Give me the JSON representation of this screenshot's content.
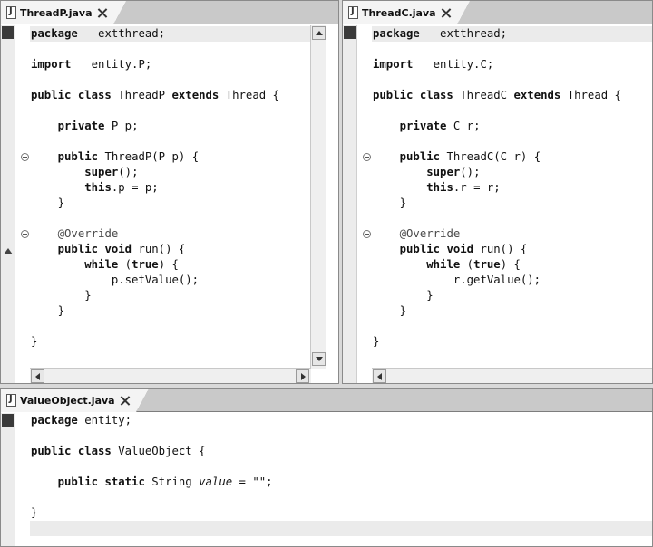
{
  "editors": {
    "threadP": {
      "tab": "ThreadP.java",
      "lines": [
        [
          [
            "kw",
            "package"
          ],
          [
            "",
            "   extthread;"
          ]
        ],
        [],
        [
          [
            "kw",
            "import"
          ],
          [
            "",
            "   entity.P;"
          ]
        ],
        [],
        [
          [
            "kw",
            "public class"
          ],
          [
            "",
            " ThreadP "
          ],
          [
            "kw",
            "extends"
          ],
          [
            "",
            " Thread {"
          ]
        ],
        [],
        [
          [
            "",
            "    "
          ],
          [
            "kw",
            "private"
          ],
          [
            "",
            " P p;"
          ]
        ],
        [],
        [
          [
            "",
            "    "
          ],
          [
            "kw",
            "public"
          ],
          [
            "",
            " ThreadP(P p) {"
          ]
        ],
        [
          [
            "",
            "        "
          ],
          [
            "kw",
            "super"
          ],
          [
            "",
            "();"
          ]
        ],
        [
          [
            "",
            "        "
          ],
          [
            "kw",
            "this"
          ],
          [
            "",
            ".p = p;"
          ]
        ],
        [
          [
            "",
            "    }"
          ]
        ],
        [],
        [
          [
            "",
            "    "
          ],
          [
            "ann",
            "@Override"
          ]
        ],
        [
          [
            "",
            "    "
          ],
          [
            "kw",
            "public void"
          ],
          [
            "",
            " run() {"
          ]
        ],
        [
          [
            "",
            "        "
          ],
          [
            "kw",
            "while"
          ],
          [
            "",
            " ("
          ],
          [
            "kw",
            "true"
          ],
          [
            "",
            ") {"
          ]
        ],
        [
          [
            "",
            "            p.setValue();"
          ]
        ],
        [
          [
            "",
            "        }"
          ]
        ],
        [
          [
            "",
            "    }"
          ]
        ],
        [],
        [
          [
            "",
            "}"
          ]
        ]
      ]
    },
    "threadC": {
      "tab": "ThreadC.java",
      "lines": [
        [
          [
            "kw",
            "package"
          ],
          [
            "",
            "   extthread;"
          ]
        ],
        [],
        [
          [
            "kw",
            "import"
          ],
          [
            "",
            "   entity.C;"
          ]
        ],
        [],
        [
          [
            "kw",
            "public class"
          ],
          [
            "",
            " ThreadC "
          ],
          [
            "kw",
            "extends"
          ],
          [
            "",
            " Thread {"
          ]
        ],
        [],
        [
          [
            "",
            "    "
          ],
          [
            "kw",
            "private"
          ],
          [
            "",
            " C r;"
          ]
        ],
        [],
        [
          [
            "",
            "    "
          ],
          [
            "kw",
            "public"
          ],
          [
            "",
            " ThreadC(C r) {"
          ]
        ],
        [
          [
            "",
            "        "
          ],
          [
            "kw",
            "super"
          ],
          [
            "",
            "();"
          ]
        ],
        [
          [
            "",
            "        "
          ],
          [
            "kw",
            "this"
          ],
          [
            "",
            ".r = r;"
          ]
        ],
        [
          [
            "",
            "    }"
          ]
        ],
        [],
        [
          [
            "",
            "    "
          ],
          [
            "ann",
            "@Override"
          ]
        ],
        [
          [
            "",
            "    "
          ],
          [
            "kw",
            "public void"
          ],
          [
            "",
            " run() {"
          ]
        ],
        [
          [
            "",
            "        "
          ],
          [
            "kw",
            "while"
          ],
          [
            "",
            " ("
          ],
          [
            "kw",
            "true"
          ],
          [
            "",
            ") {"
          ]
        ],
        [
          [
            "",
            "            r.getValue();"
          ]
        ],
        [
          [
            "",
            "        }"
          ]
        ],
        [
          [
            "",
            "    }"
          ]
        ],
        [],
        [
          [
            "",
            "}"
          ]
        ]
      ]
    },
    "valueObject": {
      "tab": "ValueObject.java",
      "lines": [
        [
          [
            "kw",
            "package"
          ],
          [
            "",
            " entity;"
          ]
        ],
        [],
        [
          [
            "kw",
            "public class"
          ],
          [
            "",
            " ValueObject {"
          ]
        ],
        [],
        [
          [
            "",
            "    "
          ],
          [
            "kw",
            "public static"
          ],
          [
            "",
            " String "
          ],
          [
            "it",
            "value"
          ],
          [
            "",
            " = \"\";"
          ]
        ],
        [],
        [
          [
            "",
            "}"
          ]
        ]
      ]
    }
  },
  "icons": {
    "file": "java-file-icon",
    "close": "close-icon",
    "fold": "fold-collapse-icon",
    "ruler_arrow": "arrow-up-icon"
  },
  "colors": {
    "current_line": "#ebebeb",
    "tab_bar": "#c9c9c9",
    "ruler_mark": "#3a3a3a"
  }
}
